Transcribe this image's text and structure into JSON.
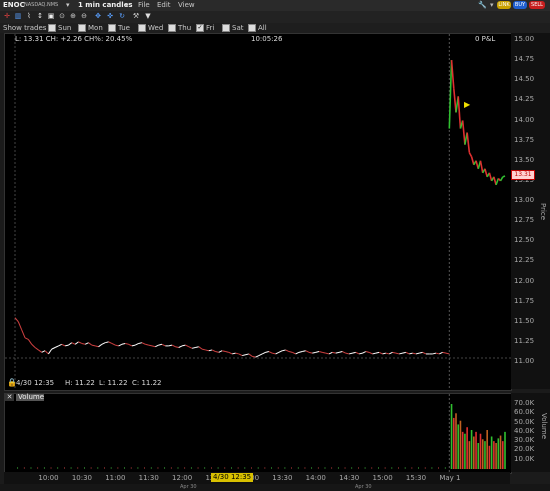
{
  "header": {
    "symbol": "ENOC",
    "exchange": "NASDAQ.NMS",
    "interval": "1 min candles",
    "menus": [
      "File",
      "Edit",
      "View"
    ],
    "buttons": [
      "LINK",
      "BUY",
      "SELL"
    ],
    "colors": {
      "link": "#c9a100",
      "buy": "#1f5fd0",
      "sell": "#c81f1f"
    }
  },
  "toolbar": {
    "icons": [
      "crosshair-icon",
      "bar-chart-icon",
      "line-chart-icon",
      "zoom-icon",
      "zoom-in-icon",
      "zoom-out-icon",
      "pan-icon",
      "move-icon",
      "refresh-icon",
      "settings-icon",
      "dropdown-icon"
    ]
  },
  "show_trades": {
    "label": "Show trades",
    "days": [
      {
        "label": "Sun",
        "checked": false
      },
      {
        "label": "Mon",
        "checked": false
      },
      {
        "label": "Tue",
        "checked": false
      },
      {
        "label": "Wed",
        "checked": false
      },
      {
        "label": "Thu",
        "checked": false
      },
      {
        "label": "Fri",
        "checked": true
      },
      {
        "label": "Sat",
        "checked": false
      },
      {
        "label": "All",
        "checked": false
      }
    ]
  },
  "price_panel": {
    "info": "L: 13.31 CH: +2.26 CH%: 20.45%",
    "time": "10:05:26",
    "pnl": "0 P&L",
    "last_price": "13.31",
    "axis_title": "Price",
    "bottom_info": {
      "date": "4/30 12:35",
      "high": "H: 11.22",
      "low": "L: 11.22",
      "close": "C: 11.22"
    }
  },
  "volume_panel": {
    "label": "Volume",
    "axis_title": "Volume"
  },
  "x_axis": {
    "highlight": "4/30 12:35"
  },
  "footer": {
    "left": "Apr 30",
    "right": "Apr 30"
  },
  "chart_data": {
    "type": "line",
    "title": "ENOC",
    "ylabel": "Price",
    "ylim": [
      11.0,
      15.0
    ],
    "y_ticks": [
      "15.00",
      "14.75",
      "14.50",
      "14.25",
      "14.00",
      "13.75",
      "13.50",
      "13.25",
      "13.00",
      "12.75",
      "12.50",
      "12.25",
      "12.00",
      "11.75",
      "11.50",
      "11.25",
      "11.00"
    ],
    "x_ticks": [
      "10:00",
      "10:30",
      "11:00",
      "11:30",
      "12:00",
      "12:30",
      "13:00",
      "13:30",
      "14:00",
      "14:30",
      "15:00",
      "15:30",
      "May 1"
    ],
    "volume_ticks": [
      "70.0K",
      "60.0K",
      "50.0K",
      "40.0K",
      "30.0K",
      "20.0K",
      "10.0K"
    ],
    "series": [
      {
        "name": "Apr 30",
        "x": [
          0,
          3,
          6,
          9,
          12,
          15,
          18,
          21,
          24,
          27,
          30,
          33,
          36,
          39,
          42,
          45,
          48,
          51,
          54,
          57,
          60,
          63,
          66,
          69,
          72,
          75,
          78,
          81,
          84,
          87,
          90,
          93,
          96,
          99,
          102,
          105,
          108,
          111,
          114,
          117,
          120,
          123,
          126,
          129,
          132,
          135,
          138,
          141,
          144,
          147,
          150,
          153,
          156,
          159,
          162,
          165,
          168,
          171,
          174,
          177,
          180,
          183,
          186,
          189,
          192,
          195,
          198,
          201,
          204,
          207,
          210,
          213,
          216,
          219,
          222,
          225,
          228,
          231,
          234,
          237,
          240,
          243,
          246,
          249,
          252,
          255,
          258,
          261,
          264,
          267,
          270,
          273,
          276,
          279,
          282,
          285,
          288,
          291,
          294,
          297,
          300,
          303,
          306,
          309,
          312,
          315,
          318,
          321,
          324,
          327,
          330,
          333,
          336,
          339,
          342,
          345,
          348,
          351,
          354,
          357,
          360,
          363,
          366,
          369,
          372,
          375,
          378,
          381,
          384,
          387,
          390
        ],
        "y": [
          11.55,
          11.5,
          11.4,
          11.3,
          11.28,
          11.22,
          11.18,
          11.15,
          11.12,
          11.14,
          11.1,
          11.16,
          11.18,
          11.2,
          11.22,
          11.2,
          11.21,
          11.24,
          11.22,
          11.25,
          11.23,
          11.22,
          11.24,
          11.21,
          11.2,
          11.19,
          11.22,
          11.24,
          11.25,
          11.23,
          11.21,
          11.2,
          11.22,
          11.23,
          11.22,
          11.2,
          11.21,
          11.23,
          11.24,
          11.22,
          11.21,
          11.2,
          11.19,
          11.21,
          11.22,
          11.2,
          11.2,
          11.21,
          11.19,
          11.18,
          11.2,
          11.21,
          11.19,
          11.17,
          11.18,
          11.19,
          11.16,
          11.15,
          11.14,
          11.15,
          11.13,
          11.12,
          11.14,
          11.13,
          11.12,
          11.1,
          11.11,
          11.1,
          11.08,
          11.09,
          11.1,
          11.07,
          11.06,
          11.08,
          11.1,
          11.12,
          11.13,
          11.11,
          11.1,
          11.12,
          11.14,
          11.15,
          11.13,
          11.12,
          11.1,
          11.12,
          11.13,
          11.14,
          11.12,
          11.11,
          11.12,
          11.13,
          11.12,
          11.11,
          11.1,
          11.12,
          11.11,
          11.12,
          11.13,
          11.11,
          11.1,
          11.11,
          11.12,
          11.1,
          11.11,
          11.13,
          11.12,
          11.1,
          11.11,
          11.12,
          11.1,
          11.11,
          11.1,
          11.12,
          11.11,
          11.1,
          11.11,
          11.12,
          11.1,
          11.11,
          11.1,
          11.11,
          11.12,
          11.1,
          11.1,
          11.1,
          11.11,
          11.1,
          11.12,
          11.11,
          11.1
        ]
      },
      {
        "name": "May 1",
        "x": [
          390,
          392,
          394,
          396,
          398,
          400,
          402,
          404,
          406,
          408,
          410,
          412,
          414,
          416,
          418,
          420,
          422,
          424,
          426,
          428,
          430,
          432,
          434,
          436,
          438,
          440
        ],
        "y": [
          13.9,
          14.75,
          14.4,
          14.1,
          14.3,
          13.9,
          14.0,
          13.7,
          13.85,
          13.6,
          13.55,
          13.45,
          13.5,
          13.4,
          13.5,
          13.35,
          13.4,
          13.3,
          13.35,
          13.25,
          13.3,
          13.2,
          13.28,
          13.25,
          13.3,
          13.31
        ]
      }
    ],
    "volume": {
      "ylim": [
        0,
        70000
      ],
      "x": [
        392,
        394,
        396,
        398,
        400,
        402,
        404,
        406,
        408,
        410,
        412,
        414,
        416,
        418,
        420,
        422,
        424,
        426,
        428,
        430,
        432,
        434,
        436,
        438,
        440
      ],
      "values": [
        70000,
        55000,
        60000,
        48000,
        52000,
        40000,
        38000,
        45000,
        30000,
        42000,
        35000,
        40000,
        28000,
        38000,
        32000,
        30000,
        42000,
        25000,
        35000,
        30000,
        28000,
        33000,
        36000,
        30000,
        40000
      ]
    }
  }
}
